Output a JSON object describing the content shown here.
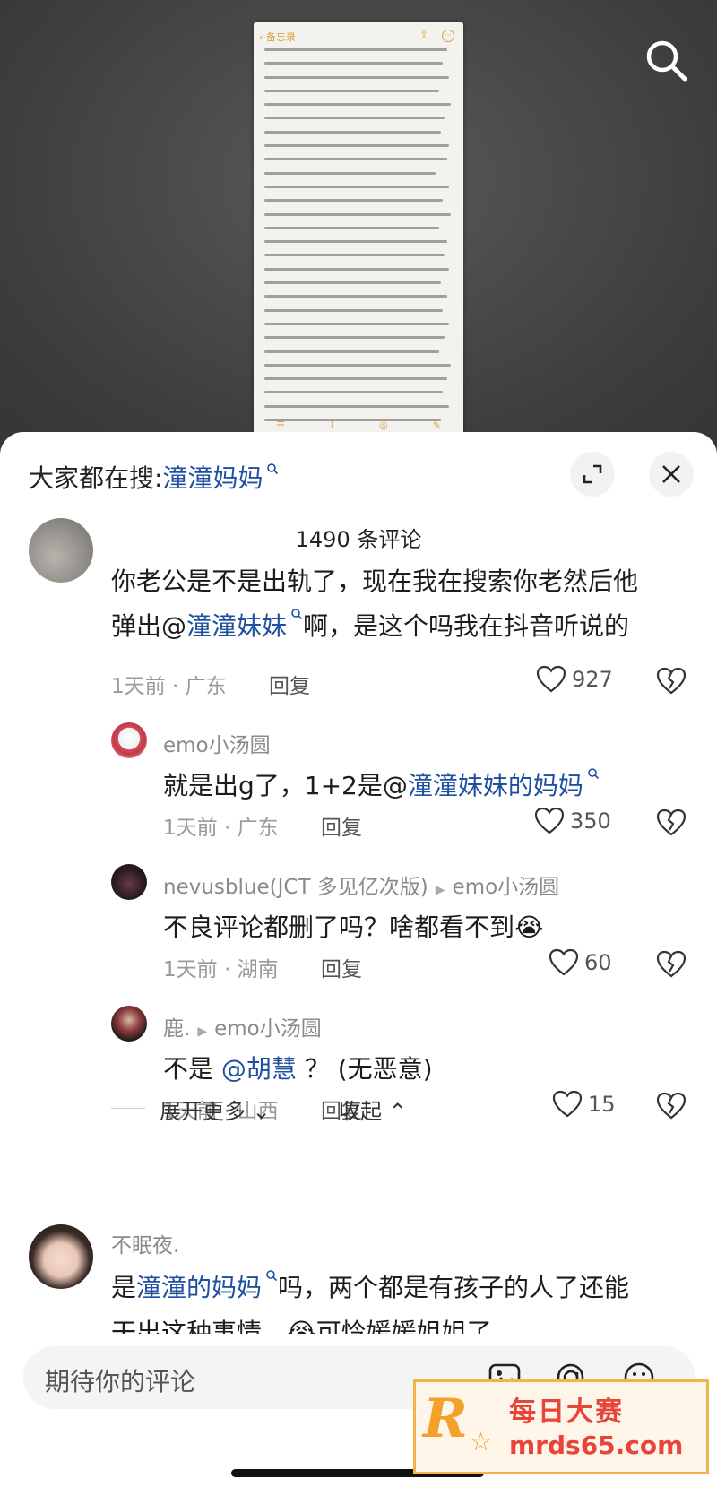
{
  "background_video": {
    "note_back_label": "备忘录"
  },
  "sheet": {
    "search_prefix": "大家都在搜:",
    "search_keyword": "潼潼妈妈",
    "comment_count": "1490 条评论"
  },
  "comments": [
    {
      "text_a": "你老公是不是出轨了，现在我在搜索你老然后他",
      "text_b1": "弹出@",
      "text_b_kw": "潼潼妹妹",
      "text_b2": "啊，是这个吗我在抖音听说的",
      "time": "1天前 · 广东",
      "reply": "回复",
      "likes": "927"
    },
    {
      "user": "emo小汤圆",
      "text_1": "就是出g了，1+2是@",
      "text_kw": "潼潼妹妹的妈妈",
      "time": "1天前 · 广东",
      "reply": "回复",
      "likes": "350"
    },
    {
      "user": "nevusblue(JCT 多见亿次版)",
      "reply_to": "emo小汤圆",
      "text": "不良评论都删了吗？啥都看不到",
      "emoji": "😭",
      "time": "1天前 · 湖南",
      "reply": "回复",
      "likes": "60"
    },
    {
      "user": "鹿.",
      "reply_to": "emo小汤圆",
      "text_1": "不是",
      "text_kw": "@胡慧",
      "text_2": "？ (无恶意)",
      "time": "1天前 · 山西",
      "reply": "回复",
      "likes": "15"
    },
    {
      "user": "不眠夜.",
      "text_1": "是",
      "text_kw": "潼潼的妈妈",
      "text_2": "吗，两个都是有孩子的人了还能",
      "text_b": "干出这种事情。",
      "emoji": "😭",
      "text_b2": "可怜媛媛姐姐了"
    }
  ],
  "expand": {
    "more": "展开更多",
    "collapse": "收起"
  },
  "input": {
    "placeholder": "期待你的评论"
  },
  "watermark": {
    "logo": "R",
    "top": "每日大赛",
    "bottom": "mrds65.com"
  },
  "colors": {
    "keyword": "#1f4fa0",
    "note_accent": "#d8a23a"
  }
}
